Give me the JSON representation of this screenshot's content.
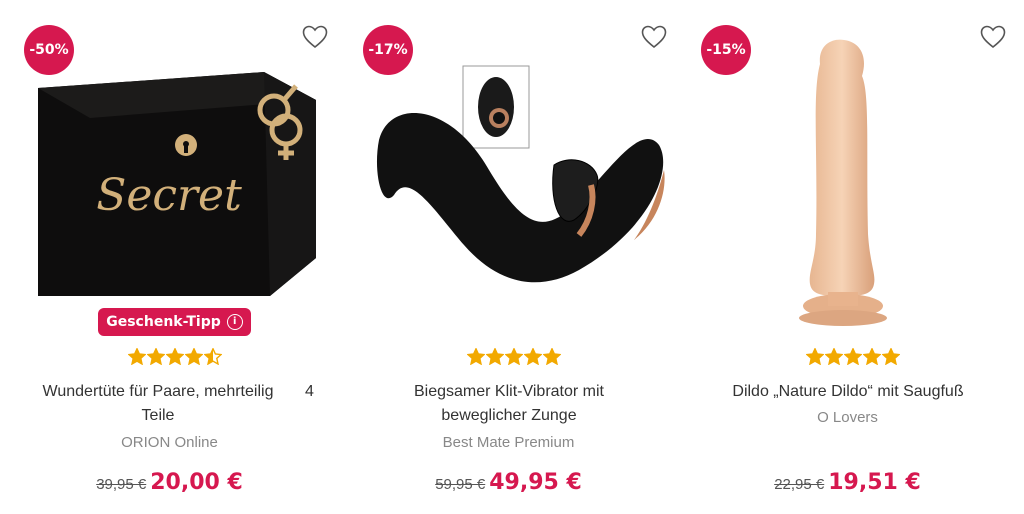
{
  "products": [
    {
      "discount": "-50%",
      "tip_label": "Geschenk-Tipp",
      "rating": 4.5,
      "title": "Wundertüte für Paare, mehrteilig Teile",
      "count": "4",
      "brand": "ORION Online",
      "old_price": "39,95 €",
      "price": "20,00 €",
      "image_text": "Secret"
    },
    {
      "discount": "-17%",
      "rating": 5,
      "title": "Biegsamer Klit-Vibrator mit beweglicher Zunge",
      "brand": "Best Mate Premium",
      "old_price": "59,95 €",
      "price": "49,95 €"
    },
    {
      "discount": "-15%",
      "rating": 5,
      "title": "Dildo „Nature Dildo“ mit Saugfuß",
      "brand": "O Lovers",
      "old_price": "22,95 €",
      "price": "19,51 €"
    }
  ],
  "colors": {
    "accent": "#d6184f",
    "star": "#f2a900",
    "text": "#333333",
    "muted": "#888888"
  }
}
